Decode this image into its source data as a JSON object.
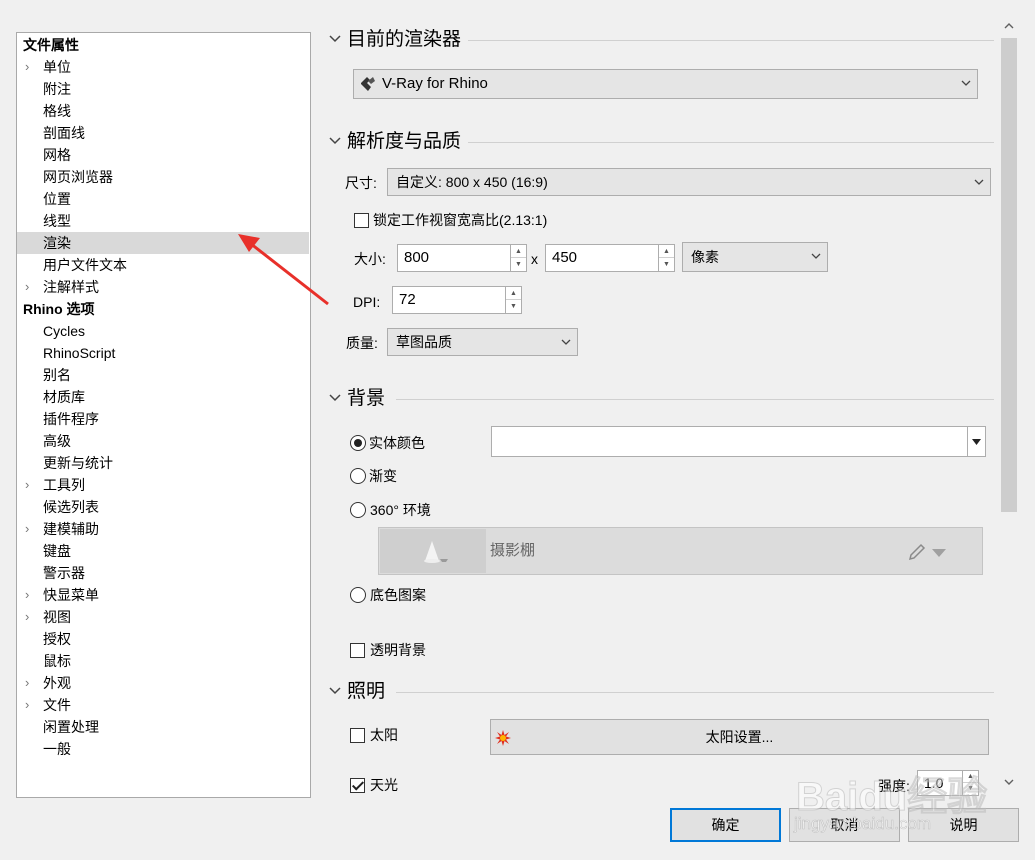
{
  "tree": {
    "doc_props_header": "文件属性",
    "doc_props": [
      {
        "label": "单位",
        "expandable": true
      },
      {
        "label": "附注",
        "expandable": false
      },
      {
        "label": "格线",
        "expandable": false
      },
      {
        "label": "剖面线",
        "expandable": false
      },
      {
        "label": "网格",
        "expandable": false
      },
      {
        "label": "网页浏览器",
        "expandable": false
      },
      {
        "label": "位置",
        "expandable": false
      },
      {
        "label": "线型",
        "expandable": false
      },
      {
        "label": "渲染",
        "expandable": false,
        "selected": true
      },
      {
        "label": "用户文件文本",
        "expandable": false
      },
      {
        "label": "注解样式",
        "expandable": true
      }
    ],
    "rhino_options_header": "Rhino 选项",
    "rhino_options": [
      {
        "label": "Cycles",
        "expandable": false
      },
      {
        "label": "RhinoScript",
        "expandable": false
      },
      {
        "label": "别名",
        "expandable": false
      },
      {
        "label": "材质库",
        "expandable": false
      },
      {
        "label": "插件程序",
        "expandable": false
      },
      {
        "label": "高级",
        "expandable": false
      },
      {
        "label": "更新与统计",
        "expandable": false
      },
      {
        "label": "工具列",
        "expandable": true
      },
      {
        "label": "候选列表",
        "expandable": false
      },
      {
        "label": "建模辅助",
        "expandable": true
      },
      {
        "label": "键盘",
        "expandable": false
      },
      {
        "label": "警示器",
        "expandable": false
      },
      {
        "label": "快显菜单",
        "expandable": true
      },
      {
        "label": "视图",
        "expandable": true
      },
      {
        "label": "授权",
        "expandable": false
      },
      {
        "label": "鼠标",
        "expandable": false
      },
      {
        "label": "外观",
        "expandable": true
      },
      {
        "label": "文件",
        "expandable": true
      },
      {
        "label": "闲置处理",
        "expandable": false
      },
      {
        "label": "一般",
        "expandable": false
      }
    ]
  },
  "current_renderer": {
    "title": "目前的渲染器",
    "renderer": "V-Ray for Rhino"
  },
  "resolution": {
    "title": "解析度与品质",
    "size_label": "尺寸:",
    "size_value": "自定义: 800 x 450 (16:9)",
    "lock_aspect_label": "锁定工作视窗宽高比(2.13:1)",
    "lock_aspect_checked": false,
    "dims_label": "大小:",
    "width": "800",
    "x_sep": "x",
    "height": "450",
    "unit": "像素",
    "dpi_label": "DPI:",
    "dpi": "72",
    "quality_label": "质量:",
    "quality": "草图品质"
  },
  "background": {
    "title": "背景",
    "solid_color_label": "实体颜色",
    "solid_color_value": "#ffffff",
    "gradient_label": "渐变",
    "env360_label": "360° 环境",
    "environment_name": "摄影棚",
    "wallpaper_label": "底色图案",
    "transparent_label": "透明背景",
    "transparent_checked": false,
    "selected": "solid_color"
  },
  "lighting": {
    "title": "照明",
    "sun_label": "太阳",
    "sun_checked": false,
    "sun_settings_button": "太阳设置...",
    "skylight_label": "天光",
    "skylight_checked": true,
    "intensity_label": "强度:",
    "intensity": "1.0"
  },
  "buttons": {
    "ok": "确定",
    "cancel": "取消",
    "help": "说明"
  },
  "watermark": {
    "brand": "Baidu经验",
    "url": "jingyan.baidu.com"
  },
  "colors": {
    "selection": "#d9d9d9",
    "default_button_border": "#0078d7",
    "annotation_arrow": "#e8302a"
  },
  "icons": [
    "chevron-right-icon",
    "chevron-down-icon",
    "vray-logo-icon",
    "studio-thumbnail-icon",
    "pencil-icon",
    "sun-icon"
  ]
}
